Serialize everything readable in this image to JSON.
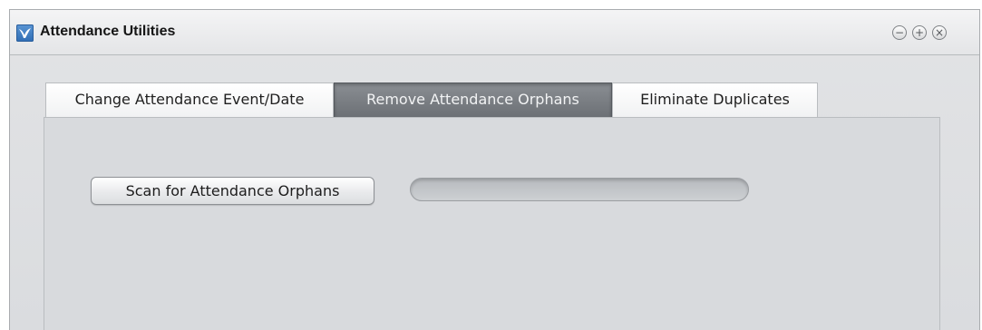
{
  "window": {
    "title": "Attendance Utilities",
    "controls": {
      "minimize_glyph": "−",
      "maximize_glyph": "+",
      "close_glyph": "×"
    }
  },
  "tabs": [
    {
      "label": "Change Attendance Event/Date",
      "active": false
    },
    {
      "label": "Remove Attendance Orphans",
      "active": true
    },
    {
      "label": "Eliminate Duplicates",
      "active": false
    }
  ],
  "panel": {
    "scan_button_label": "Scan for Attendance Orphans",
    "progress_fraction": 0
  },
  "colors": {
    "active_tab": "#6c7075",
    "window_background": "#dadcdf",
    "app_icon": "#2f6db4"
  },
  "icons": {
    "app": "app-logo-icon"
  }
}
